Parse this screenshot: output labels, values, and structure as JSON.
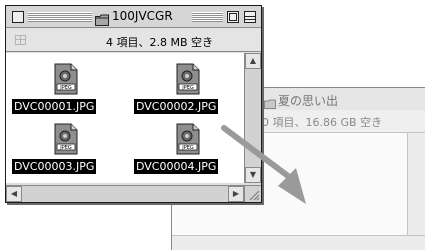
{
  "back_window": {
    "title": "夏の思い出",
    "info": "0 項目、16.86 GB 空き"
  },
  "front_window": {
    "title": "100JVCGR",
    "info": "4 項目、2.8 MB 空き",
    "files": [
      {
        "name": "DVC00001.JPG",
        "icon": "jpeg-file-icon"
      },
      {
        "name": "DVC00002.JPG",
        "icon": "jpeg-file-icon"
      },
      {
        "name": "DVC00003.JPG",
        "icon": "jpeg-file-icon"
      },
      {
        "name": "DVC00004.JPG",
        "icon": "jpeg-file-icon"
      }
    ]
  },
  "icons": {
    "folder": "folder-icon",
    "file": "jpeg-file-icon",
    "drag_arrow": "arrow-icon",
    "jpeg_badge": "JPEG"
  },
  "colors": {
    "selection": "#000000",
    "arrow": "#9a9a9a"
  }
}
